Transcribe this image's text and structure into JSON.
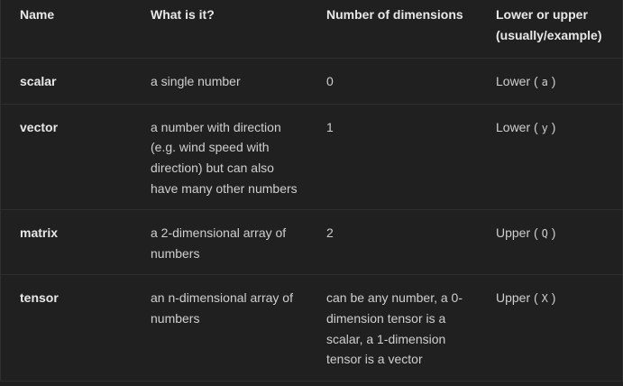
{
  "table": {
    "headers": [
      "Name",
      "What is it?",
      "Number of dimensions",
      "Lower or upper (usually/example)"
    ],
    "rows": [
      {
        "name": "scalar",
        "what": "a single number",
        "dims": "0",
        "case_word": "Lower",
        "case_example": "a"
      },
      {
        "name": "vector",
        "what": "a number with direction (e.g. wind speed with direction) but can also have many other numbers",
        "dims": "1",
        "case_word": "Lower",
        "case_example": "y"
      },
      {
        "name": "matrix",
        "what": "a 2-dimensional array of numbers",
        "dims": "2",
        "case_word": "Upper",
        "case_example": "Q"
      },
      {
        "name": "tensor",
        "what": "an n-dimensional array of numbers",
        "dims": "can be any number, a 0-dimension tensor is a scalar, a 1-dimension tensor is a vector",
        "case_word": "Upper",
        "case_example": "X"
      }
    ]
  }
}
